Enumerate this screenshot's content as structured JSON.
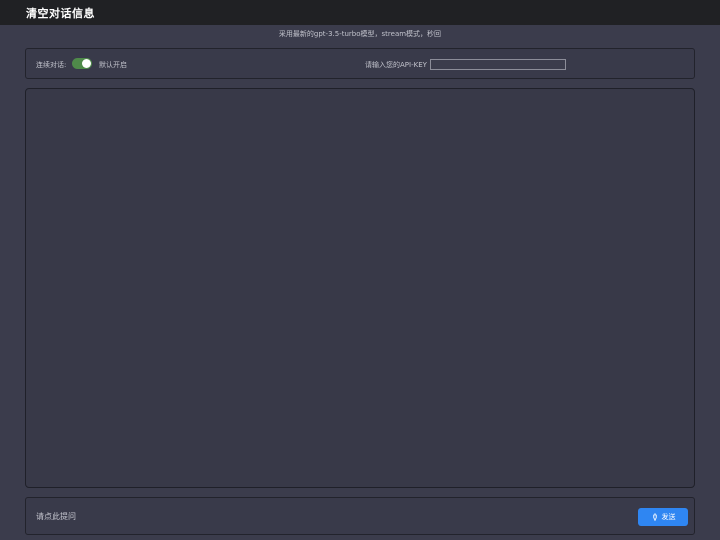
{
  "header": {
    "title": "清空对话信息"
  },
  "subtitle": "采用最新的gpt-3.5-turbo模型，stream模式，秒回",
  "settings": {
    "continuous_label": "连续对话:",
    "continuous_enabled": true,
    "default_on_label": "默认开启",
    "apikey_label": "请输入您的API-KEY",
    "apikey_value": ""
  },
  "chat": {
    "messages": []
  },
  "composer": {
    "placeholder": "请点此提问",
    "value": "",
    "send_label": "发送",
    "send_icon": "rocket-icon"
  },
  "colors": {
    "topbar": "#202124",
    "background": "#3b3c4c",
    "switch_on": "#4f8a4a",
    "send_button": "#2f86f2"
  }
}
